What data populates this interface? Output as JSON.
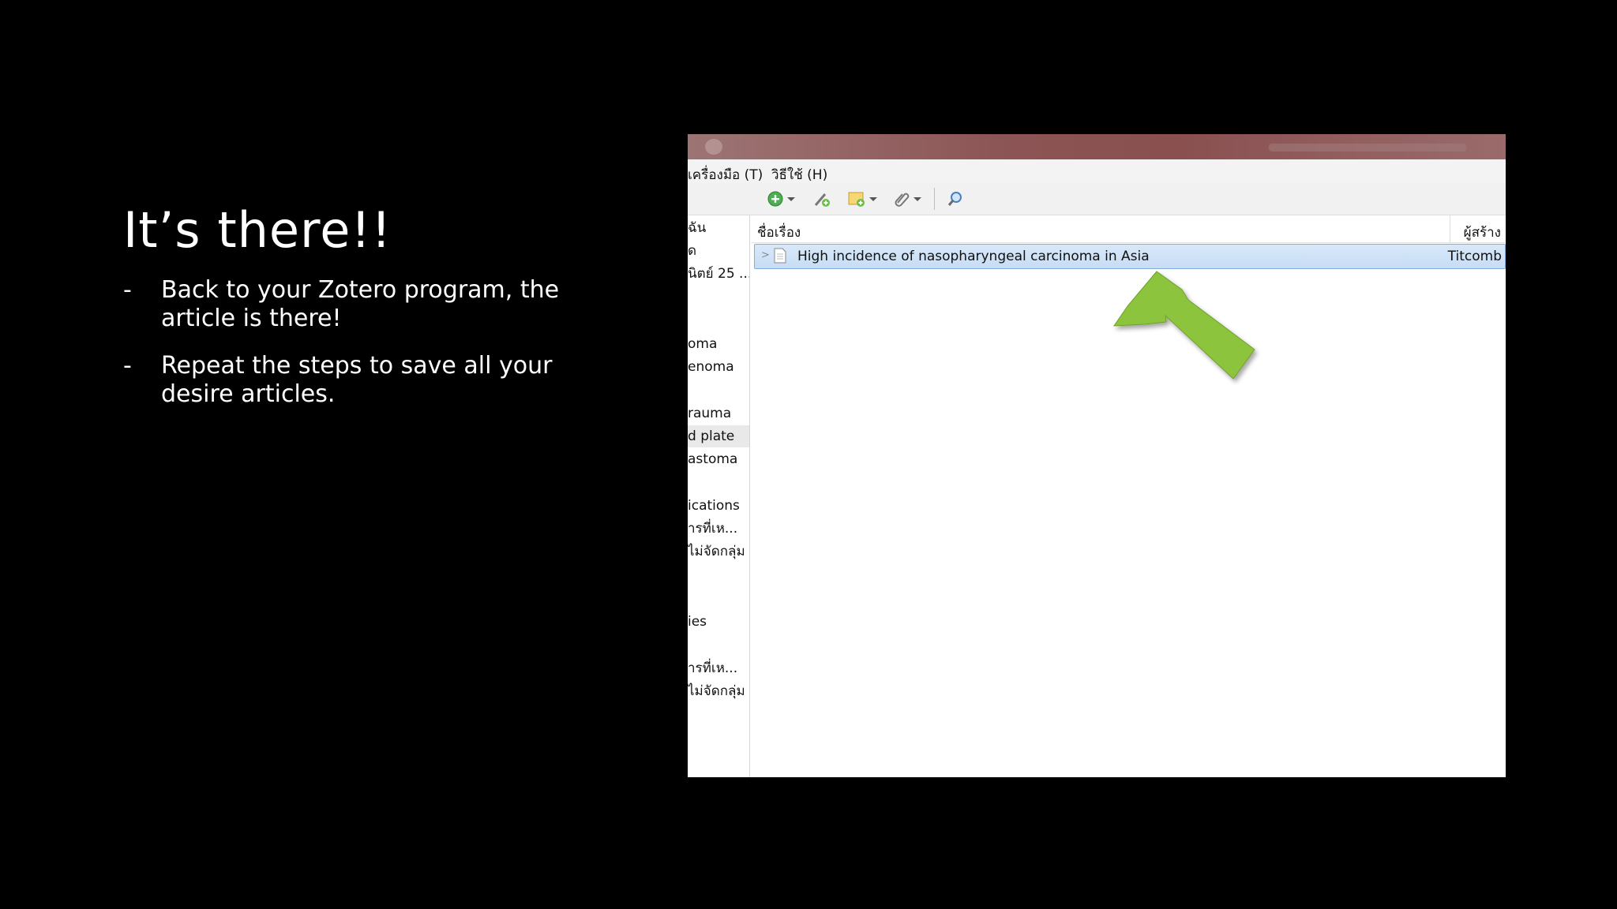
{
  "slide": {
    "title": "It’s there!!",
    "bullets": [
      {
        "dash": "-",
        "text": "Back to your Zotero program, the article is there!"
      },
      {
        "dash": "-",
        "text": "Repeat the steps to save all your desire articles."
      }
    ]
  },
  "app": {
    "menu": {
      "tools": "เครื่องมือ (T)",
      "help": "วิธีใช้ (H)"
    },
    "toolbar": {
      "new_item_icon": "plus-circle-icon",
      "add_by_identifier_icon": "magic-wand-icon",
      "new_note_icon": "note-icon",
      "attachment_icon": "paperclip-icon",
      "search_icon": "magnifier-icon"
    },
    "left_pane_items": [
      "ฉัน",
      "ด",
      "นิตย์ 25 ...",
      "oma",
      "enoma",
      "rauma",
      "d plate",
      "astoma",
      "ications",
      "ารที่เห...",
      "ไม่จัดกลุ่ม",
      "ies",
      "ารที่เห...",
      "ไม่จัดกลุ่ม"
    ],
    "selected_left_item_index": 6,
    "columns": {
      "title": "ชื่อเรื่อง",
      "creator": "ผู้สร้าง"
    },
    "items": [
      {
        "title": "High incidence of nasopharyngeal carcinoma in Asia",
        "creator": "Titcomb"
      }
    ]
  },
  "colors": {
    "highlight_row": "#c7ddf4",
    "arrow": "#8cc43c",
    "titlebar": "#8c5454"
  }
}
